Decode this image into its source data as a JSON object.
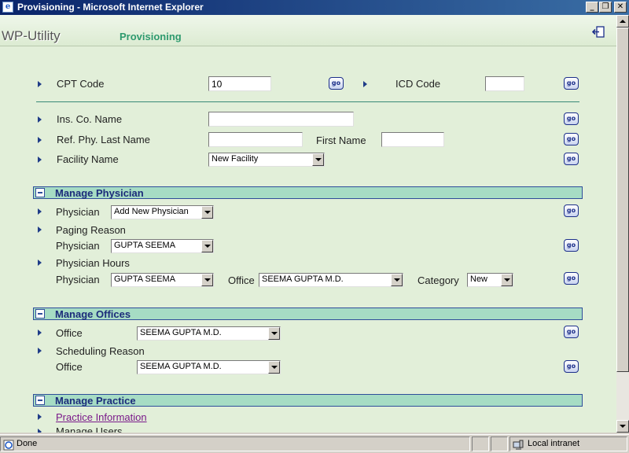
{
  "window": {
    "title": "Provisioning - Microsoft Internet Explorer",
    "app_icon_glyph": "e",
    "minimize": "_",
    "restore": "❐",
    "close": "✕"
  },
  "header": {
    "logo": "WP-Utility",
    "subtitle": "Provisioning",
    "exit_icon": "exit-icon"
  },
  "go_label": "go",
  "codes": {
    "cpt_label": "CPT Code",
    "cpt_value": "10",
    "icd_label": "ICD Code",
    "icd_value": ""
  },
  "search": {
    "ins_co_label": "Ins. Co. Name",
    "ref_phy_label": "Ref. Phy. Last Name",
    "first_name_label": "First Name",
    "facility_label": "Facility Name",
    "facility_value": "New Facility"
  },
  "manage_physician": {
    "title": "Manage Physician",
    "physician_label": "Physician",
    "physician_value": "Add New Physician",
    "paging_reason_label": "Paging Reason",
    "paging_physician_value": "GUPTA SEEMA",
    "physician_hours_label": "Physician Hours",
    "hours_physician_value": "GUPTA SEEMA",
    "office_label": "Office",
    "office_value": "SEEMA GUPTA M.D.",
    "category_label": "Category",
    "category_value": "New"
  },
  "manage_offices": {
    "title": "Manage Offices",
    "office_label": "Office",
    "office_value": "SEEMA GUPTA M.D.",
    "scheduling_reason_label": "Scheduling Reason",
    "sched_office_value": "SEEMA GUPTA M.D."
  },
  "manage_practice": {
    "title": "Manage Practice",
    "practice_info_link": "Practice Information",
    "manage_users_label": "Manage Users"
  },
  "status": {
    "text": "Done",
    "zone": "Local intranet"
  }
}
